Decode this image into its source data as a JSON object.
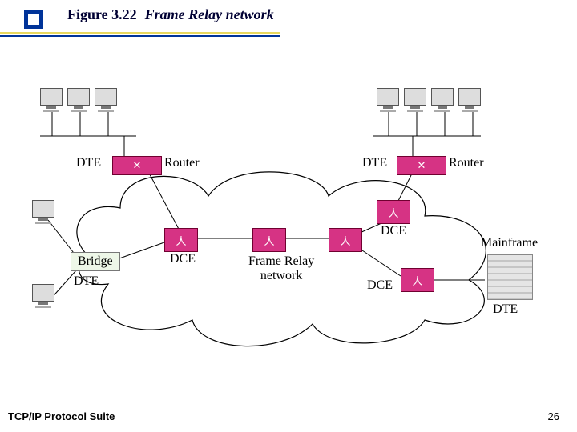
{
  "figure_label": "Figure 3.22",
  "figure_title": "Frame Relay network",
  "footer": {
    "left": "TCP/IP Protocol Suite",
    "page": "26"
  },
  "labels": {
    "dte1": "DTE",
    "dte2": "DTE",
    "dte3": "DTE",
    "dte4": "DTE",
    "router1": "Router",
    "router2": "Router",
    "bridge": "Bridge",
    "dce1": "DCE",
    "dce2": "DCE",
    "dce3": "DCE",
    "network_name": "Frame Relay\nnetwork",
    "mainframe": "Mainframe"
  }
}
